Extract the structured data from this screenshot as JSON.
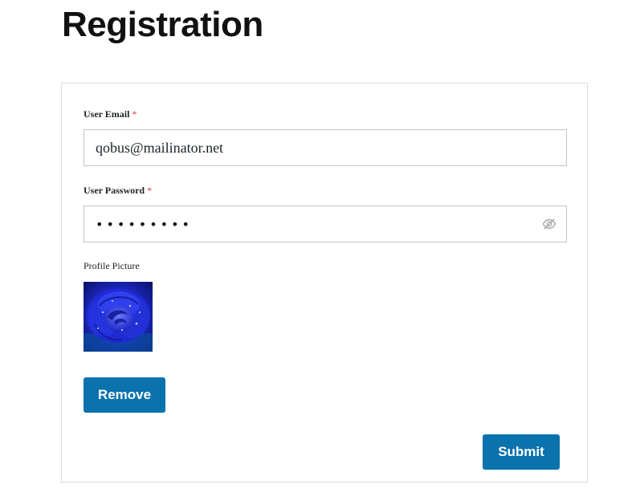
{
  "page": {
    "title": "Registration"
  },
  "form": {
    "email": {
      "label": "User Email",
      "required_mark": "*",
      "value": "qobus@mailinator.net"
    },
    "password": {
      "label": "User Password",
      "required_mark": "*",
      "masked_value": "•••••••••",
      "toggle_icon": "eye-slash-icon"
    },
    "profile_picture": {
      "label": "Profile Picture",
      "image": "blue-rose-photo"
    },
    "remove_label": "Remove",
    "submit_label": "Submit"
  },
  "colors": {
    "button": "#0a72ad",
    "required": "#d63638",
    "border": "#c3c4c7"
  }
}
